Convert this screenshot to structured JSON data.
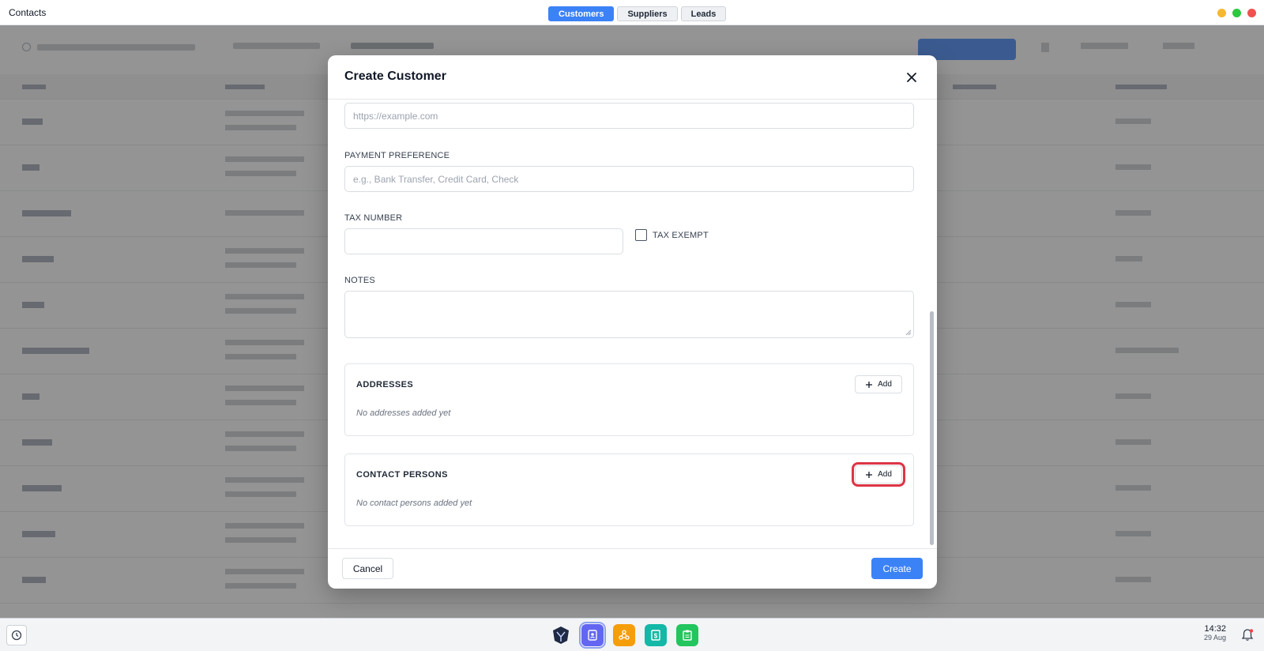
{
  "app": {
    "title": "Contacts"
  },
  "tabs": [
    {
      "label": "Customers",
      "active": true
    },
    {
      "label": "Suppliers",
      "active": false
    },
    {
      "label": "Leads",
      "active": false
    }
  ],
  "modal": {
    "title": "Create Customer",
    "website": {
      "placeholder": "https://example.com"
    },
    "payment_preference": {
      "label": "PAYMENT PREFERENCE",
      "placeholder": "e.g., Bank Transfer, Credit Card, Check"
    },
    "tax_number": {
      "label": "TAX NUMBER",
      "value": ""
    },
    "tax_exempt": {
      "label": "TAX EXEMPT",
      "checked": false
    },
    "notes": {
      "label": "NOTES",
      "value": ""
    },
    "addresses": {
      "title": "ADDRESSES",
      "add_label": "Add",
      "empty": "No addresses added yet"
    },
    "contact_persons": {
      "title": "CONTACT PERSONS",
      "add_label": "Add",
      "empty": "No contact persons added yet"
    },
    "footer": {
      "cancel_label": "Cancel",
      "create_label": "Create"
    }
  },
  "taskbar": {
    "time": "14:32",
    "date": "29 Aug"
  },
  "colors": {
    "accent": "#3b82f6",
    "highlight": "#dc3545"
  },
  "icons": [
    "close-icon",
    "plus-icon",
    "clock-icon",
    "bell-icon",
    "app-logo-icon",
    "contacts-app-icon",
    "network-app-icon",
    "spreadsheet-app-icon",
    "clipboard-app-icon"
  ]
}
